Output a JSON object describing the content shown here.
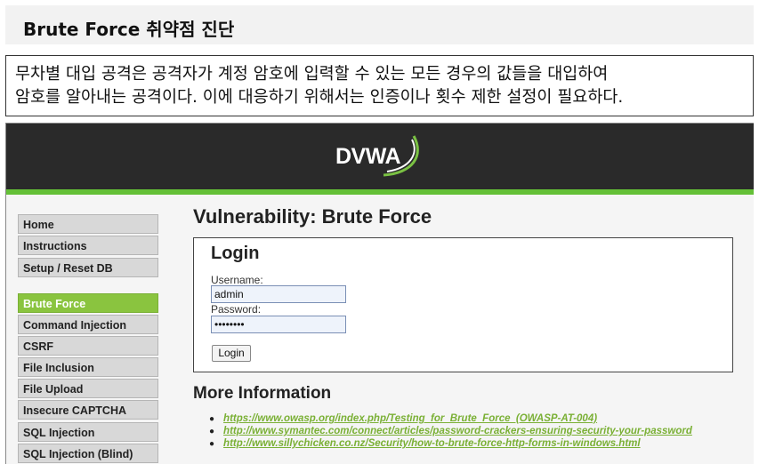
{
  "section": {
    "title": "Brute Force 취약점 진단",
    "description_line1": "무차별 대입 공격은 공격자가 계정 암호에 입력할 수 있는 모든 경우의 값들을 대입하여",
    "description_line2": "암호를 알아내는 공격이다. 이에 대응하기 위해서는 인증이나 횟수 제한 설정이 필요하다."
  },
  "dvwa": {
    "logo_text": "DVWA",
    "colors": {
      "header": "#2a2a2a",
      "accent_green": "#64c037",
      "active_menu": "#8ac43f",
      "link": "#7ab035"
    },
    "menu": [
      {
        "label": "Home"
      },
      {
        "label": "Instructions"
      },
      {
        "label": "Setup / Reset DB"
      },
      {
        "label": "Brute Force",
        "active": true
      },
      {
        "label": "Command Injection"
      },
      {
        "label": "CSRF"
      },
      {
        "label": "File Inclusion"
      },
      {
        "label": "File Upload"
      },
      {
        "label": "Insecure CAPTCHA"
      },
      {
        "label": "SQL Injection"
      },
      {
        "label": "SQL Injection (Blind)"
      }
    ],
    "page_title": "Vulnerability: Brute Force",
    "login": {
      "title": "Login",
      "username_label": "Username:",
      "username_value": "admin",
      "password_label": "Password:",
      "password_value": "••••••••",
      "button_label": "Login"
    },
    "more_info": {
      "title": "More Information",
      "links": [
        "https://www.owasp.org/index.php/Testing_for_Brute_Force_(OWASP-AT-004)",
        "http://www.symantec.com/connect/articles/password-crackers-ensuring-security-your-password",
        "http://www.sillychicken.co.nz/Security/how-to-brute-force-http-forms-in-windows.html"
      ]
    }
  }
}
